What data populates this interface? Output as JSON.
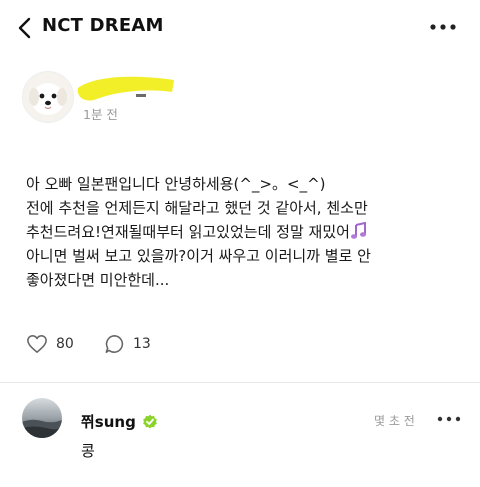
{
  "header": {
    "title": "NCT DREAM",
    "back_icon": "chevron-left-icon",
    "more_icon": "more-dots-icon"
  },
  "post": {
    "time": "1분 전",
    "lines": [
      "아 오빠 일본팬입니다 안녕하세용(^_>。<_^)",
      "전에 추천을 언제든지 해달라고 했던 것 같아서, 첸소만",
      "추천드려요!연재될때부터 읽고있었는데 정말 재밌어",
      "아니면 벌써 보고 있을까?이거 싸우고 이러니까 별로 안",
      "좋아졌다면 미안한데..."
    ],
    "likes": "80",
    "comments": "13"
  },
  "reply": {
    "name": "쮜sung",
    "time": "몇 초 전",
    "text": "콩"
  },
  "colors": {
    "highlight": "#f2ee27",
    "verified": "#8bd22a",
    "music": "#b07ad6"
  }
}
